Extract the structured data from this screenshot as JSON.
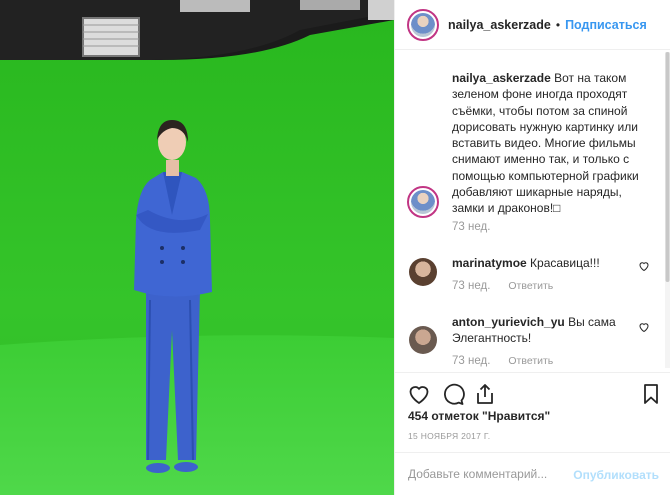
{
  "post": {
    "username": "nailya_askerzade",
    "separator": "•",
    "follow_label": "Подписаться"
  },
  "caption": {
    "username": "nailya_askerzade",
    "text": "Вот на таком зеленом фоне иногда проходят съёмки, чтобы потом за спиной дорисовать нужную картинку или вставить видео. Многие фильмы снимают именно так, и только с помощью компьютерной графики добавляют шикарные наряды, замки и драконов!□",
    "time": "73 нед."
  },
  "comments": [
    {
      "username": "marinatymoe",
      "text": "Красавица!!!",
      "time": "73 нед.",
      "reply": "Ответить"
    },
    {
      "username": "anton_yurievich_yu",
      "text": "Вы сама Элегантность!",
      "time": "73 нед.",
      "reply": "Ответить"
    }
  ],
  "likes_text": "454 отметок \"Нравится\"",
  "date_text": "15 НОЯБРЯ 2017 Г.",
  "add_comment": {
    "placeholder": "Добавьте комментарий...",
    "publish_label": "Опубликовать"
  },
  "icons": {
    "like": "heart-icon",
    "comment": "comment-icon",
    "share": "share-icon",
    "save": "bookmark-icon"
  },
  "colors": {
    "accent": "#3897f0",
    "publish_disabled": "#b2dffc",
    "green_screen": "#2fc02a",
    "suit": "#3a5fc8"
  }
}
